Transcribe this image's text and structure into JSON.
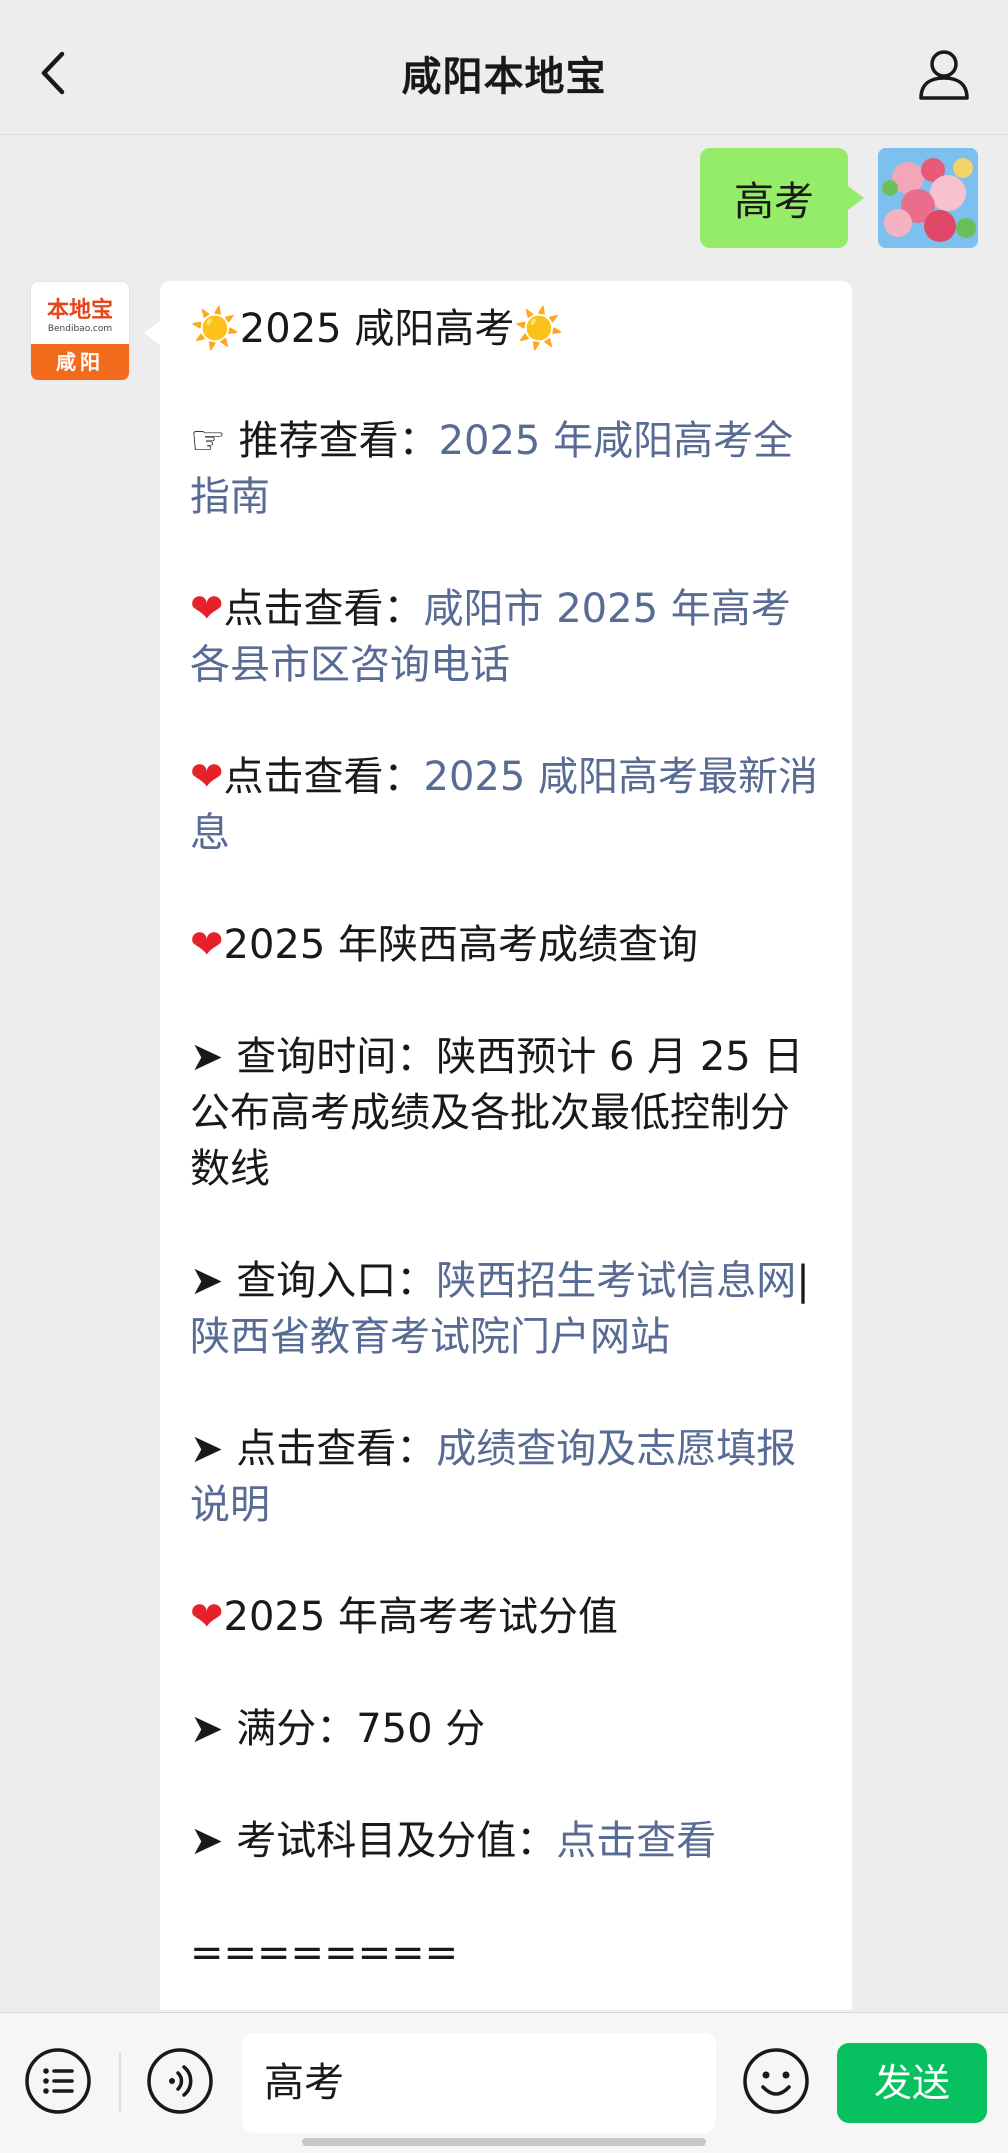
{
  "header": {
    "title": "咸阳本地宝",
    "back_icon": "chevron-left-icon",
    "profile_icon": "person-icon"
  },
  "conversation": {
    "user_message": "高考",
    "bot_avatar": {
      "brand": "本地宝",
      "brand_sub": "Bendibao.com",
      "city": "咸阳"
    },
    "bot_message": {
      "title": "☀️2025 咸阳高考☀️",
      "recommend": {
        "prefix": "☞ 推荐查看：",
        "link": "2025 年咸阳高考全指南"
      },
      "consult": {
        "prefix": "点击查看：",
        "link": "咸阳市 2025 年高考各县市区咨询电话"
      },
      "news": {
        "prefix": "点击查看：",
        "link": "2025 咸阳高考最新消息"
      },
      "score_heading": "2025 年陕西高考成绩查询",
      "query_time": "➤ 查询时间：陕西预计 6 月 25 日公布高考成绩及各批次最低控制分数线",
      "query_entry": {
        "prefix": "➤ 查询入口：",
        "link1": "陕西招生考试信息网",
        "separator": "|",
        "link2": "陕西省教育考试院门户网站"
      },
      "score_guide": {
        "prefix": "➤ 点击查看：",
        "link": "成绩查询及志愿填报说明"
      },
      "exam_heading": "2025 年高考考试分值",
      "full_score": "➤ 满分：750 分",
      "subjects": {
        "prefix": "➤ 考试科目及分值：",
        "link": "点击查看"
      },
      "separator_line": "========"
    }
  },
  "input_bar": {
    "text_value": "高考",
    "send_label": "发送",
    "list_icon": "list-icon",
    "voice_icon": "voice-icon",
    "emoji_icon": "emoji-icon"
  },
  "colors": {
    "background": "#ededed",
    "user_bubble": "#95ec69",
    "link": "#576b95",
    "send_button": "#07c160",
    "heart": "#e8202a"
  }
}
